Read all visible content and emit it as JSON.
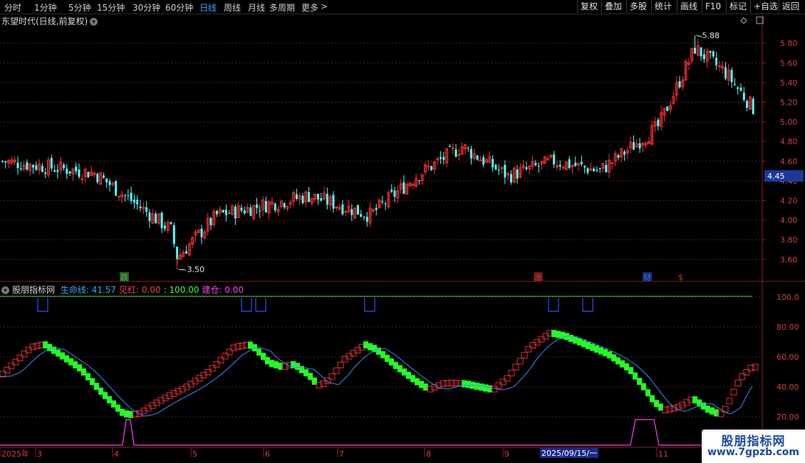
{
  "toolbar": {
    "periods": [
      {
        "label": "分时",
        "active": false
      },
      {
        "label": "1分钟",
        "active": false
      },
      {
        "label": "5分钟",
        "active": false
      },
      {
        "label": "15分钟",
        "active": false
      },
      {
        "label": "30分钟",
        "active": false
      },
      {
        "label": "60分钟",
        "active": false
      },
      {
        "label": "日线",
        "active": true
      },
      {
        "label": "周线",
        "active": false
      },
      {
        "label": "月线",
        "active": false
      },
      {
        "label": "多周期",
        "active": false
      },
      {
        "label": "更多",
        "active": false
      }
    ],
    "more_arrow": ">",
    "buttons": [
      "复权",
      "叠加",
      "多股",
      "统计",
      "画线",
      "F10",
      "标记",
      "+自选",
      "返回"
    ]
  },
  "price_panel": {
    "title": "东望时代(日线,前复权)",
    "dropdown_icon": "chevron-down-icon",
    "current_price": "4.45",
    "high_label": "5.88",
    "low_label": "3.50",
    "y_ticks": [
      "5.80",
      "5.60",
      "5.40",
      "5.20",
      "5.00",
      "4.80",
      "4.60",
      "4.40",
      "4.20",
      "4.00",
      "3.80",
      "3.60"
    ],
    "markers": [
      {
        "text": "跌",
        "color": "#40c040"
      },
      {
        "text": "涨",
        "color": "#e03030"
      },
      {
        "text": "财",
        "color": "#3070ff"
      },
      {
        "text": "$",
        "color": "#e03030"
      }
    ],
    "colors": {
      "up": "#ff3030",
      "down": "#54ffff",
      "grid": "#5a1a1a",
      "axis": "#d04040"
    }
  },
  "indicator_panel": {
    "name": "股朋指标网",
    "fields": [
      {
        "label": "生命线:",
        "value": "41.57",
        "color": "#35a8ff"
      },
      {
        "label": "见红:",
        "value": "0.00",
        "color": "#ff4040"
      },
      {
        "label": ":",
        "value": "100.00",
        "color": "#40ff40"
      },
      {
        "label": "建仓:",
        "value": "0.00",
        "color": "#ff40ff"
      }
    ],
    "y_ticks": [
      "100.0",
      "80.00",
      "60.00",
      "40.00",
      "20.00"
    ]
  },
  "date_axis": {
    "labels": [
      "2025年",
      "3",
      "4",
      "5",
      "6",
      "7",
      "8",
      "9",
      "2025/09/15/一",
      "11"
    ]
  },
  "watermark": {
    "line1": "股朋指标网",
    "line2": "www.7gpzb.com"
  }
}
